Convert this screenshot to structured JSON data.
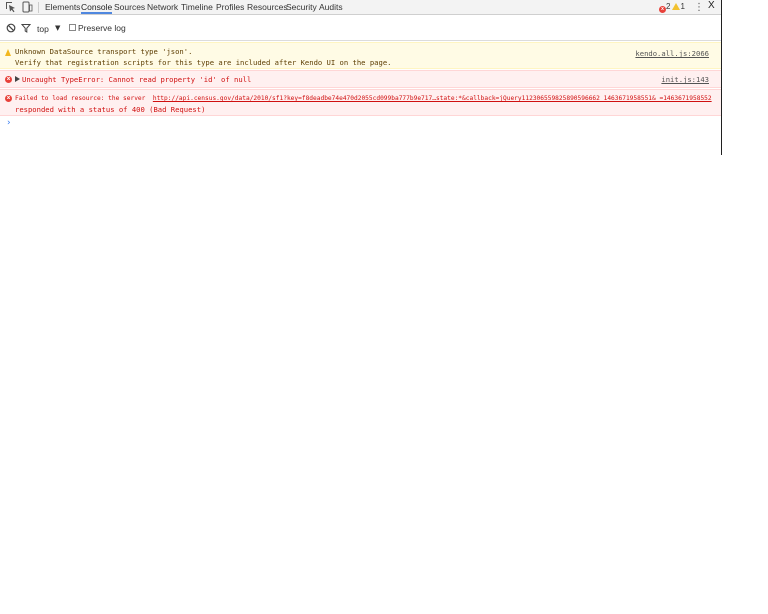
{
  "tabs": [
    {
      "label": "Elements",
      "active": false
    },
    {
      "label": "Console",
      "active": true
    },
    {
      "label": "Sources",
      "active": false
    },
    {
      "label": "Network",
      "active": false
    },
    {
      "label": "Timeline",
      "active": false
    },
    {
      "label": "Profiles",
      "active": false
    },
    {
      "label": "Resources",
      "active": false
    },
    {
      "label": "Security",
      "active": false
    },
    {
      "label": "Audits",
      "active": false
    }
  ],
  "counts": {
    "errors": "2",
    "warnings": "1"
  },
  "window": {
    "close_label": "X",
    "menu_label": "⋮"
  },
  "toolbar": {
    "context": "top",
    "context_arrow": "▼",
    "preserve_log": "Preserve log"
  },
  "icons": {
    "inspect": "inspect-element-icon",
    "device": "device-mode-icon",
    "clear": "clear-console-icon",
    "filter": "filter-icon"
  },
  "colors": {
    "accent": "#4f87df",
    "error": "#d01010",
    "warning_bg": "#fffbe5",
    "error_bg": "#fff0f0"
  },
  "messages": [
    {
      "level": "warning",
      "line1": "Unknown DataSource transport type 'json'.",
      "line2": "Verify that registration scripts for this type are included after Kendo UI on the page.",
      "source": "kendo.all.js:2066"
    },
    {
      "level": "error",
      "line1": "Uncaught TypeError: Cannot read property 'id' of null",
      "source": "init.js:143"
    },
    {
      "level": "error",
      "prefix": "Failed to load resource: the server  ",
      "url": "http://api.census.gov/data/2010/sf1?key=f8deadbe74e470d2055cd099ba777b9e717…state:*&callback=jQuery112306559825890596662_1463671958551&_=1463671958552",
      "line2": "responded with a status of 400 (Bad Request)"
    }
  ],
  "prompt": "›"
}
